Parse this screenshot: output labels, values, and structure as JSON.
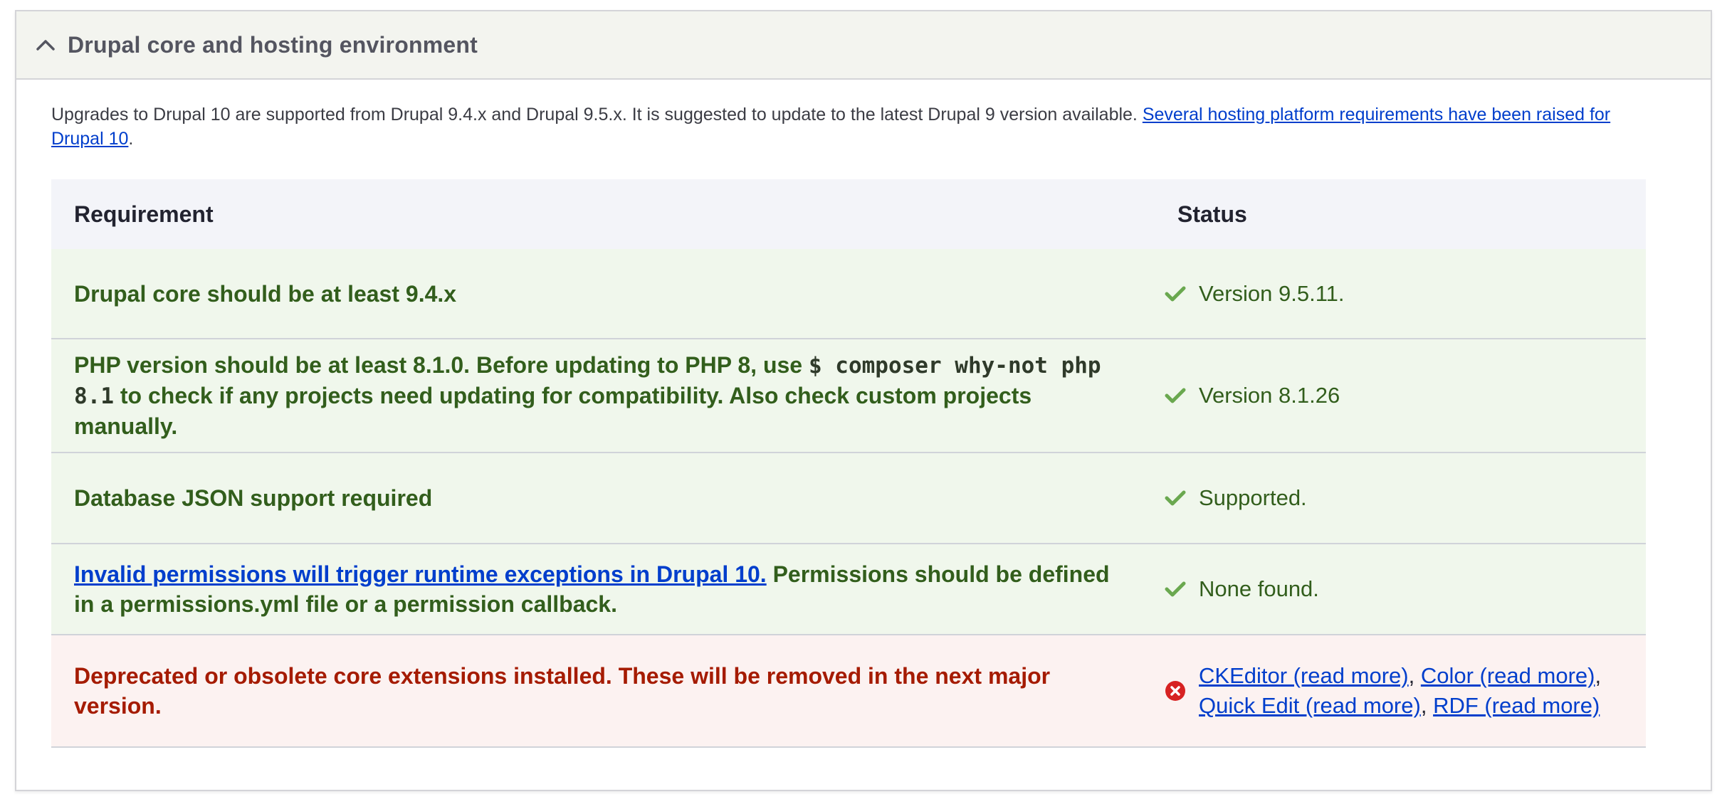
{
  "panel": {
    "title": "Drupal core and hosting environment",
    "expanded": true
  },
  "intro": {
    "text": "Upgrades to Drupal 10 are supported from Drupal 9.4.x and Drupal 9.5.x. It is suggested to update to the latest Drupal 9 version available. ",
    "link_text": "Several hosting platform requirements have been raised for Drupal 10",
    "trailing": "."
  },
  "table": {
    "headers": {
      "requirement": "Requirement",
      "status": "Status"
    },
    "rows": [
      {
        "state": "ok",
        "requirement": "Drupal core should be at least 9.4.x",
        "status": "Version 9.5.11."
      },
      {
        "state": "ok",
        "requirement_before": "PHP version should be at least 8.1.0. Before updating to PHP 8, use ",
        "requirement_code": "$ composer why-not php 8.1",
        "requirement_after": " to check if any projects need updating for compatibility. Also check custom projects manually.",
        "status": "Version 8.1.26"
      },
      {
        "state": "ok",
        "requirement": "Database JSON support required",
        "status": "Supported."
      },
      {
        "state": "ok",
        "requirement_link": "Invalid permissions will trigger runtime exceptions in Drupal 10.",
        "requirement_after": " Permissions should be defined in a permissions.yml file or a permission callback.",
        "status": "None found."
      },
      {
        "state": "error",
        "requirement": "Deprecated or obsolete core extensions installed. These will be removed in the next major version.",
        "status_links": [
          "CKEditor (read more)",
          "Color (read more)",
          "Quick Edit (read more)",
          "RDF (read more)"
        ],
        "status_separator": ", "
      }
    ]
  },
  "colors": {
    "ok_text": "#325e1c",
    "ok_bg": "#f0f7ec",
    "error_text": "#a51b00",
    "error_bg": "#fcf2f1",
    "link": "#003ecc",
    "check_icon": "#6aa84f",
    "error_icon": "#d72222"
  },
  "icons": {
    "toggle": "chevron-up-icon",
    "ok": "checkmark-icon",
    "error": "error-circle-x-icon"
  }
}
